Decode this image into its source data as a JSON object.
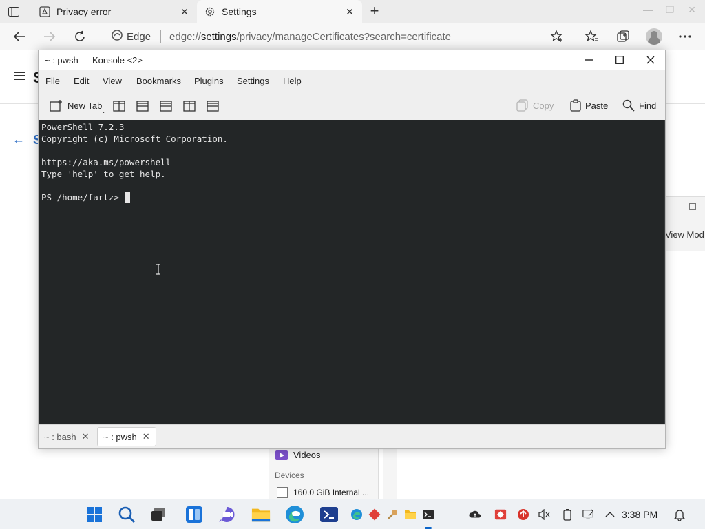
{
  "browser": {
    "tabs": [
      {
        "title": "Privacy error",
        "icon": "privacy-error-icon"
      },
      {
        "title": "Settings",
        "icon": "gear-icon"
      }
    ],
    "address_prefix": "Edge",
    "url_host": "edge://",
    "url_path_bold": "settings",
    "url_rest": "/privacy/manageCertificates?search=certificate"
  },
  "background": {
    "settings_heading_fragment": "S",
    "section_heading_fragment": "S",
    "dialog_text": "View Mod",
    "file_sidebar": {
      "videos": "Videos",
      "devices": "Devices",
      "disk": "160.0 GiB Internal ..."
    }
  },
  "konsole": {
    "title": "~ : pwsh — Konsole <2>",
    "menu": [
      "File",
      "Edit",
      "View",
      "Bookmarks",
      "Plugins",
      "Settings",
      "Help"
    ],
    "toolbar": {
      "new_tab": "New Tab",
      "copy": "Copy",
      "paste": "Paste",
      "find": "Find"
    },
    "terminal_lines": [
      "PowerShell 7.2.3",
      "Copyright (c) Microsoft Corporation.",
      "",
      "https://aka.ms/powershell",
      "Type 'help' to get help.",
      "",
      "PS /home/fartz> "
    ],
    "session_tabs": [
      {
        "label": "~ : bash"
      },
      {
        "label": "~ : pwsh"
      }
    ],
    "colors": {
      "terminal_bg": "#232627",
      "terminal_fg": "#e6e6e6"
    }
  },
  "taskbar": {
    "clock": "3:38 PM",
    "apps": [
      "windows-start-icon",
      "search-icon",
      "task-view-icon",
      "widgets-icon",
      "chat-icon",
      "file-explorer-icon",
      "edge-icon",
      "powershell-icon"
    ],
    "colors": {
      "accent": "#0a64c8"
    }
  }
}
